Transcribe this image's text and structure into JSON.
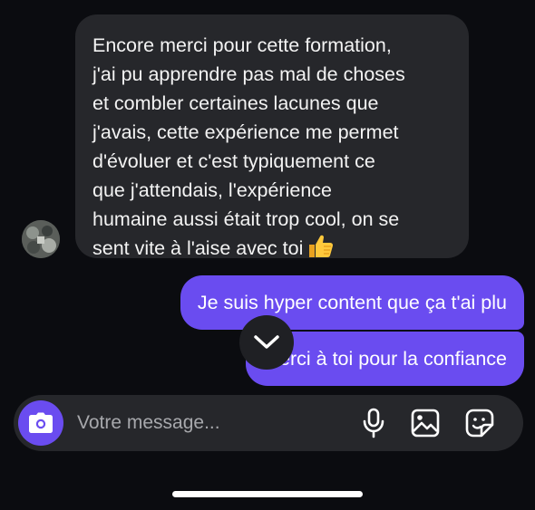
{
  "conversation": {
    "incoming": {
      "text": "Encore merci pour cette formation,\nj'ai pu apprendre pas mal de choses\net combler certaines lacunes que\nj'avais, cette expérience me permet\nd'évoluer et c'est typiquement ce\nque j'attendais, l'expérience\nhumaine aussi était trop cool, on se\nsent vite à l'aise avec toi",
      "emoji": "thumbs-up"
    },
    "outgoing": [
      {
        "text": "Je suis hyper content que ça t'ai plu"
      },
      {
        "text": "Merci à toi pour la confiance"
      }
    ]
  },
  "scroll_button": {
    "icon": "chevron-down-icon"
  },
  "composer": {
    "placeholder": "Votre message...",
    "icons": [
      "camera-icon",
      "microphone-icon",
      "gallery-icon",
      "sticker-icon"
    ]
  },
  "colors": {
    "background": "#0b0c10",
    "incoming_bubble": "#26272b",
    "outgoing_bubble": "#6a4cf0",
    "accent": "#6a4cf0"
  }
}
